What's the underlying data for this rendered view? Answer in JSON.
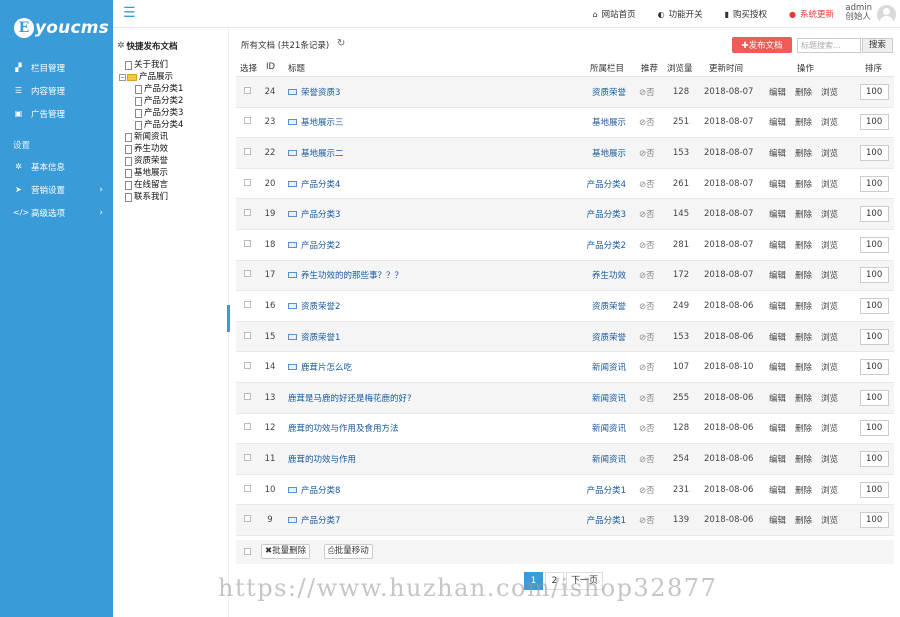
{
  "brand": {
    "badge": "E",
    "name": "youcms"
  },
  "sidebar": {
    "items": [
      {
        "label": "栏目管理",
        "icon": "sitemap-icon",
        "glyph": "▞"
      },
      {
        "label": "内容管理",
        "icon": "list-icon",
        "glyph": "☰"
      },
      {
        "label": "广告管理",
        "icon": "image-icon",
        "glyph": "▣"
      }
    ],
    "section": "设置",
    "settings": [
      {
        "label": "基本信息",
        "icon": "gear-icon",
        "glyph": "✲",
        "arrow": ""
      },
      {
        "label": "营销设置",
        "icon": "send-icon",
        "glyph": "➤",
        "arrow": "›"
      },
      {
        "label": "高级选项",
        "icon": "code-icon",
        "glyph": "</>",
        "arrow": "›"
      }
    ]
  },
  "header": {
    "links": [
      {
        "label": "网站首页",
        "icon": "home-icon",
        "glyph": "⌂",
        "red": false
      },
      {
        "label": "功能开关",
        "icon": "toggle-icon",
        "glyph": "◐",
        "red": false
      },
      {
        "label": "购买授权",
        "icon": "bookmark-icon",
        "glyph": "▮",
        "red": false
      },
      {
        "label": "系统更新",
        "icon": "alert-icon",
        "glyph": "●",
        "red": true
      }
    ],
    "user_name": "admin",
    "user_role": "创始人"
  },
  "tree": {
    "title": "快捷发布文档",
    "nodes": [
      {
        "label": "关于我们",
        "type": "doc",
        "level": "l1"
      },
      {
        "label": "产品展示",
        "type": "folder",
        "level": "l1b",
        "toggle": "−"
      },
      {
        "label": "产品分类1",
        "type": "doc",
        "level": "l2"
      },
      {
        "label": "产品分类2",
        "type": "doc",
        "level": "l2"
      },
      {
        "label": "产品分类3",
        "type": "doc",
        "level": "l2"
      },
      {
        "label": "产品分类4",
        "type": "doc",
        "level": "l2"
      },
      {
        "label": "新闻资讯",
        "type": "doc",
        "level": "l1"
      },
      {
        "label": "养生功效",
        "type": "doc",
        "level": "l1"
      },
      {
        "label": "资质荣誉",
        "type": "doc",
        "level": "l1"
      },
      {
        "label": "基地展示",
        "type": "doc",
        "level": "l1"
      },
      {
        "label": "在线留言",
        "type": "doc",
        "level": "l1"
      },
      {
        "label": "联系我们",
        "type": "doc",
        "level": "l1"
      }
    ]
  },
  "toolbar": {
    "title": "所有文档 (共21条记录)",
    "publish_label": "✚发布文档",
    "search_placeholder": "标题搜索...",
    "search_label": "搜索"
  },
  "table": {
    "headers": {
      "select": "选择",
      "id": "ID",
      "title": "标题",
      "category": "所属栏目",
      "recommend": "推荐",
      "views": "浏览量",
      "updated": "更新时间",
      "actions": "操作",
      "sort": "排序"
    },
    "action_labels": {
      "edit": "编辑",
      "delete": "删除",
      "view": "浏览"
    },
    "rows": [
      {
        "id": "24",
        "title": "荣誉资质3",
        "has_img": true,
        "category": "资质荣誉",
        "recommend": "⊘否",
        "views": "128",
        "date": "2018-08-07",
        "sort": "100"
      },
      {
        "id": "23",
        "title": "基地展示三",
        "has_img": true,
        "category": "基地展示",
        "recommend": "⊘否",
        "views": "251",
        "date": "2018-08-07",
        "sort": "100"
      },
      {
        "id": "22",
        "title": "基地展示二",
        "has_img": true,
        "category": "基地展示",
        "recommend": "⊘否",
        "views": "153",
        "date": "2018-08-07",
        "sort": "100"
      },
      {
        "id": "20",
        "title": "产品分类4",
        "has_img": true,
        "category": "产品分类4",
        "recommend": "⊘否",
        "views": "261",
        "date": "2018-08-07",
        "sort": "100"
      },
      {
        "id": "19",
        "title": "产品分类3",
        "has_img": true,
        "category": "产品分类3",
        "recommend": "⊘否",
        "views": "145",
        "date": "2018-08-07",
        "sort": "100"
      },
      {
        "id": "18",
        "title": "产品分类2",
        "has_img": true,
        "category": "产品分类2",
        "recommend": "⊘否",
        "views": "281",
        "date": "2018-08-07",
        "sort": "100"
      },
      {
        "id": "17",
        "title": "养生功效的的那些事？？？",
        "has_img": true,
        "category": "养生功效",
        "recommend": "⊘否",
        "views": "172",
        "date": "2018-08-07",
        "sort": "100"
      },
      {
        "id": "16",
        "title": "资质荣誉2",
        "has_img": true,
        "category": "资质荣誉",
        "recommend": "⊘否",
        "views": "249",
        "date": "2018-08-06",
        "sort": "100"
      },
      {
        "id": "15",
        "title": "资质荣誉1",
        "has_img": true,
        "category": "资质荣誉",
        "recommend": "⊘否",
        "views": "153",
        "date": "2018-08-06",
        "sort": "100"
      },
      {
        "id": "14",
        "title": "鹿茸片怎么吃",
        "has_img": true,
        "category": "新闻资讯",
        "recommend": "⊘否",
        "views": "107",
        "date": "2018-08-10",
        "sort": "100"
      },
      {
        "id": "13",
        "title": "鹿茸是马鹿的好还是梅花鹿的好?",
        "has_img": false,
        "category": "新闻资讯",
        "recommend": "⊘否",
        "views": "255",
        "date": "2018-08-06",
        "sort": "100"
      },
      {
        "id": "12",
        "title": "鹿茸的功效与作用及食用方法",
        "has_img": false,
        "category": "新闻资讯",
        "recommend": "⊘否",
        "views": "128",
        "date": "2018-08-06",
        "sort": "100"
      },
      {
        "id": "11",
        "title": "鹿茸的功效与作用",
        "has_img": false,
        "category": "新闻资讯",
        "recommend": "⊘否",
        "views": "254",
        "date": "2018-08-06",
        "sort": "100"
      },
      {
        "id": "10",
        "title": "产品分类8",
        "has_img": true,
        "category": "产品分类1",
        "recommend": "⊘否",
        "views": "231",
        "date": "2018-08-06",
        "sort": "100"
      },
      {
        "id": "9",
        "title": "产品分类7",
        "has_img": true,
        "category": "产品分类1",
        "recommend": "⊘否",
        "views": "139",
        "date": "2018-08-06",
        "sort": "100"
      }
    ]
  },
  "batch": {
    "delete_label": "✖批量删除",
    "move_label": "⎙批量移动"
  },
  "pager": {
    "pages": [
      "1",
      "2"
    ],
    "next_label": "下一页"
  },
  "watermark": "https://www.huzhan.com/ishop32877",
  "colors": {
    "accent": "#3a9bd9",
    "publish": "#f05b57",
    "alert": "#e33333",
    "link": "#1a5aa0"
  }
}
